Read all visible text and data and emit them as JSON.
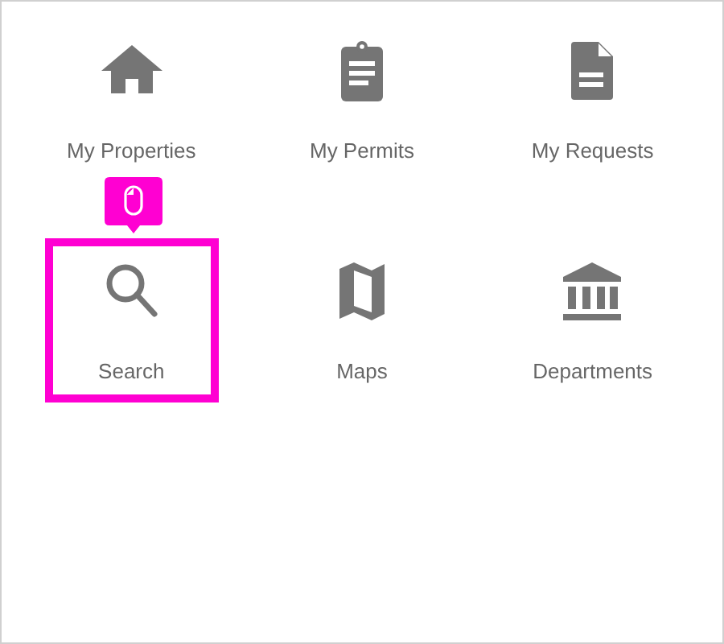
{
  "tiles": [
    {
      "label": "My Properties",
      "selected": false
    },
    {
      "label": "My Permits",
      "selected": false
    },
    {
      "label": "My Requests",
      "selected": false
    },
    {
      "label": "Search",
      "selected": true
    },
    {
      "label": "Maps",
      "selected": false
    },
    {
      "label": "Departments",
      "selected": false
    }
  ]
}
